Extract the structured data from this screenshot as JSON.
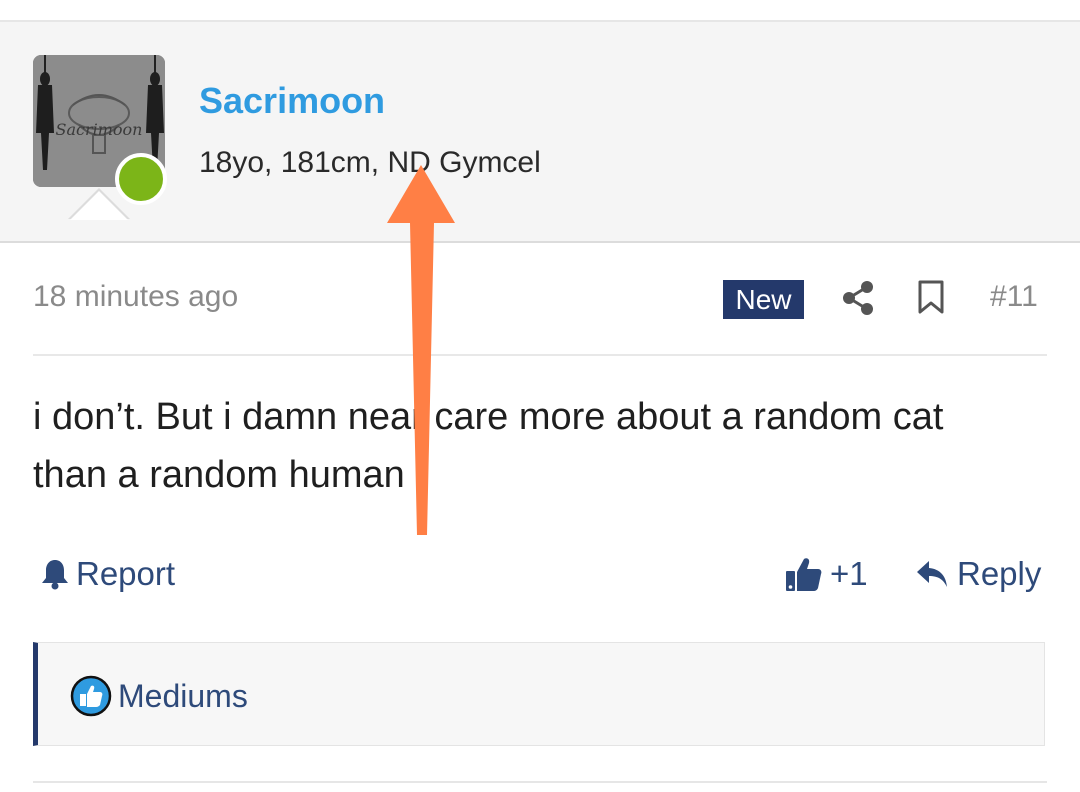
{
  "user": {
    "username": "Sacrimoon",
    "title": "18yo, 181cm, ND Gymcel",
    "avatar_text": "Sacrimoon",
    "online": true
  },
  "post": {
    "timestamp": "18 minutes ago",
    "badge": "New",
    "number": "#11",
    "body_line1": "i don’t. But i damn near care more about a random cat",
    "body_line2": "than a random human"
  },
  "actions": {
    "report_label": "Report",
    "like_label": "+1",
    "reply_label": "Reply"
  },
  "reactions": {
    "label": "Mediums"
  },
  "colors": {
    "username": "#2f9be0",
    "badge_bg": "#24396b",
    "online": "#7cb518",
    "arrow": "#ff7f45"
  },
  "icons": [
    "share-icon",
    "bookmark-icon",
    "bell-icon",
    "thumbs-up-icon",
    "reply-icon",
    "like-reaction-icon",
    "up-arrow-icon"
  ]
}
